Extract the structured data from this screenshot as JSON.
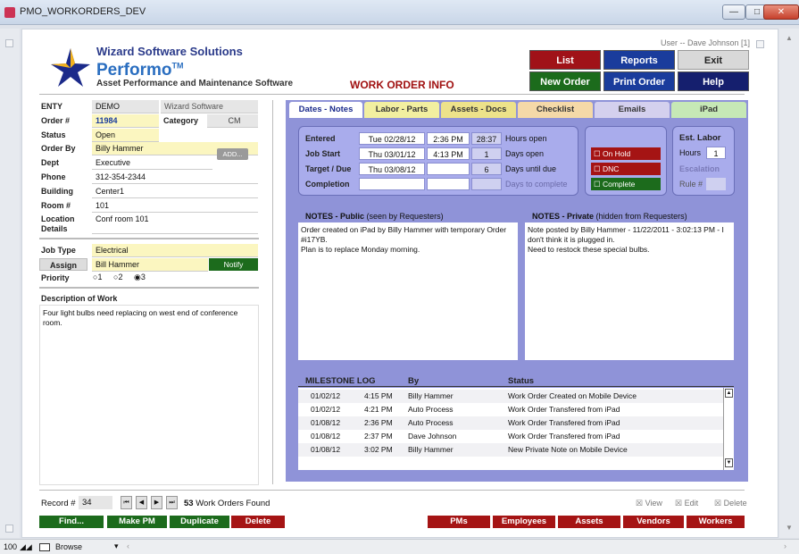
{
  "window": {
    "title": "PMO_WORKORDERS_DEV"
  },
  "header": {
    "company": "Wizard Software Solutions",
    "brand": "Performo",
    "tm": "TM",
    "subtitle": "Asset Performance and Maintenance Software",
    "page_title": "WORK ORDER INFO",
    "user": "User -- Dave Johnson [1]"
  },
  "buttons": {
    "list": "List",
    "reports": "Reports",
    "exit": "Exit",
    "new_order": "New Order",
    "print_order": "Print Order",
    "help": "Help"
  },
  "fields": {
    "entity_label": "ENTY",
    "entity_value": "DEMO",
    "entity_name": "Wizard Software",
    "order_label": "Order #",
    "order_value": "11984",
    "category_label": "Category",
    "category_value": "CM",
    "status_label": "Status",
    "status_value": "Open",
    "orderby_label": "Order By",
    "orderby_value": "Billy Hammer",
    "add_label": "ADD...",
    "dept_label": "Dept",
    "dept_value": "Executive",
    "phone_label": "Phone",
    "phone_value": "312-354-2344",
    "building_label": "Building",
    "building_value": "Center1",
    "room_label": "Room #",
    "room_value": "101",
    "location_label": "Location",
    "details_label": "Details",
    "location_value": "Conf room 101",
    "jobtype_label": "Job Type",
    "jobtype_value": "Electrical",
    "assign_label": "Assign",
    "assign_value": "Bill Hammer",
    "notify_label": "Notify",
    "priority_label": "Priority",
    "priority_options": [
      "1",
      "2",
      "3"
    ],
    "priority_selected": "3",
    "description_label": "Description of Work",
    "description_text": "Four light bulbs need replacing on west end of conference room."
  },
  "tabs": [
    "Dates - Notes",
    "Labor - Parts",
    "Assets - Docs",
    "Checklist",
    "Emails",
    "iPad"
  ],
  "dates": {
    "entered_label": "Entered",
    "entered_date": "Tue 02/28/12",
    "entered_time": "2:36 PM",
    "entered_num": "28:37",
    "entered_unit": "Hours open",
    "jobstart_label": "Job Start",
    "jobstart_date": "Thu 03/01/12",
    "jobstart_time": "4:13 PM",
    "jobstart_num": "1",
    "jobstart_unit": "Days open",
    "target_label": "Target / Due",
    "target_date": "Thu 03/08/12",
    "target_num": "6",
    "target_unit": "Days until due",
    "completion_label": "Completion",
    "completion_unit": "Days to complete"
  },
  "flags": {
    "onhold": "On Hold",
    "dnc": "DNC",
    "complete": "Complete"
  },
  "labor": {
    "title": "Est. Labor",
    "hours_label": "Hours",
    "hours_value": "1",
    "escalation_label": "Escalation",
    "rule_label": "Rule #"
  },
  "notes": {
    "public_title": "NOTES - Public",
    "public_sub": "(seen by Requesters)",
    "public_text": "Order created on iPad by Billy Hammer with temporary Order #i17YB.\nPlan is to replace Monday morning.",
    "private_title": "NOTES - Private",
    "private_sub": "(hidden from Requesters)",
    "private_text": "Note posted by Billy Hammer - 11/22/2011 - 3:02:13 PM - I don't think it is plugged in.\nNeed to restock these special bulbs."
  },
  "milestone": {
    "title": "MILESTONE LOG",
    "by_label": "By",
    "status_label": "Status",
    "rows": [
      {
        "date": "01/02/12",
        "time": "4:15 PM",
        "by": "Billy Hammer",
        "status": "Work Order Created on Mobile Device"
      },
      {
        "date": "01/02/12",
        "time": "4:21 PM",
        "by": "Auto Process",
        "status": "Work Order Transfered from iPad"
      },
      {
        "date": "01/08/12",
        "time": "2:36 PM",
        "by": "Auto Process",
        "status": "Work Order Transfered from iPad"
      },
      {
        "date": "01/08/12",
        "time": "2:37 PM",
        "by": "Dave Johnson",
        "status": "Work Order Transfered from iPad"
      },
      {
        "date": "01/08/12",
        "time": "3:02 PM",
        "by": "Billy Hammer",
        "status": "New Private Note on Mobile Device"
      }
    ]
  },
  "footer": {
    "record_label": "Record #",
    "record_value": "34",
    "found_count": "53",
    "found_text": "Work Orders Found",
    "view": "View",
    "edit": "Edit",
    "delete": "Delete"
  },
  "bottom_buttons": {
    "find": "Find...",
    "make_pm": "Make PM",
    "duplicate": "Duplicate",
    "delete": "Delete",
    "pms": "PMs",
    "employees": "Employees",
    "assets": "Assets",
    "vendors": "Vendors",
    "workers": "Workers"
  },
  "statusbar": {
    "zoom": "100",
    "mode": "Browse"
  },
  "colors": {
    "panel": "#8f93d8",
    "dark_red": "#a51414",
    "dark_green": "#1c6b1c",
    "navy": "#1a2a8c",
    "yellow_field": "#fbf6c0"
  }
}
